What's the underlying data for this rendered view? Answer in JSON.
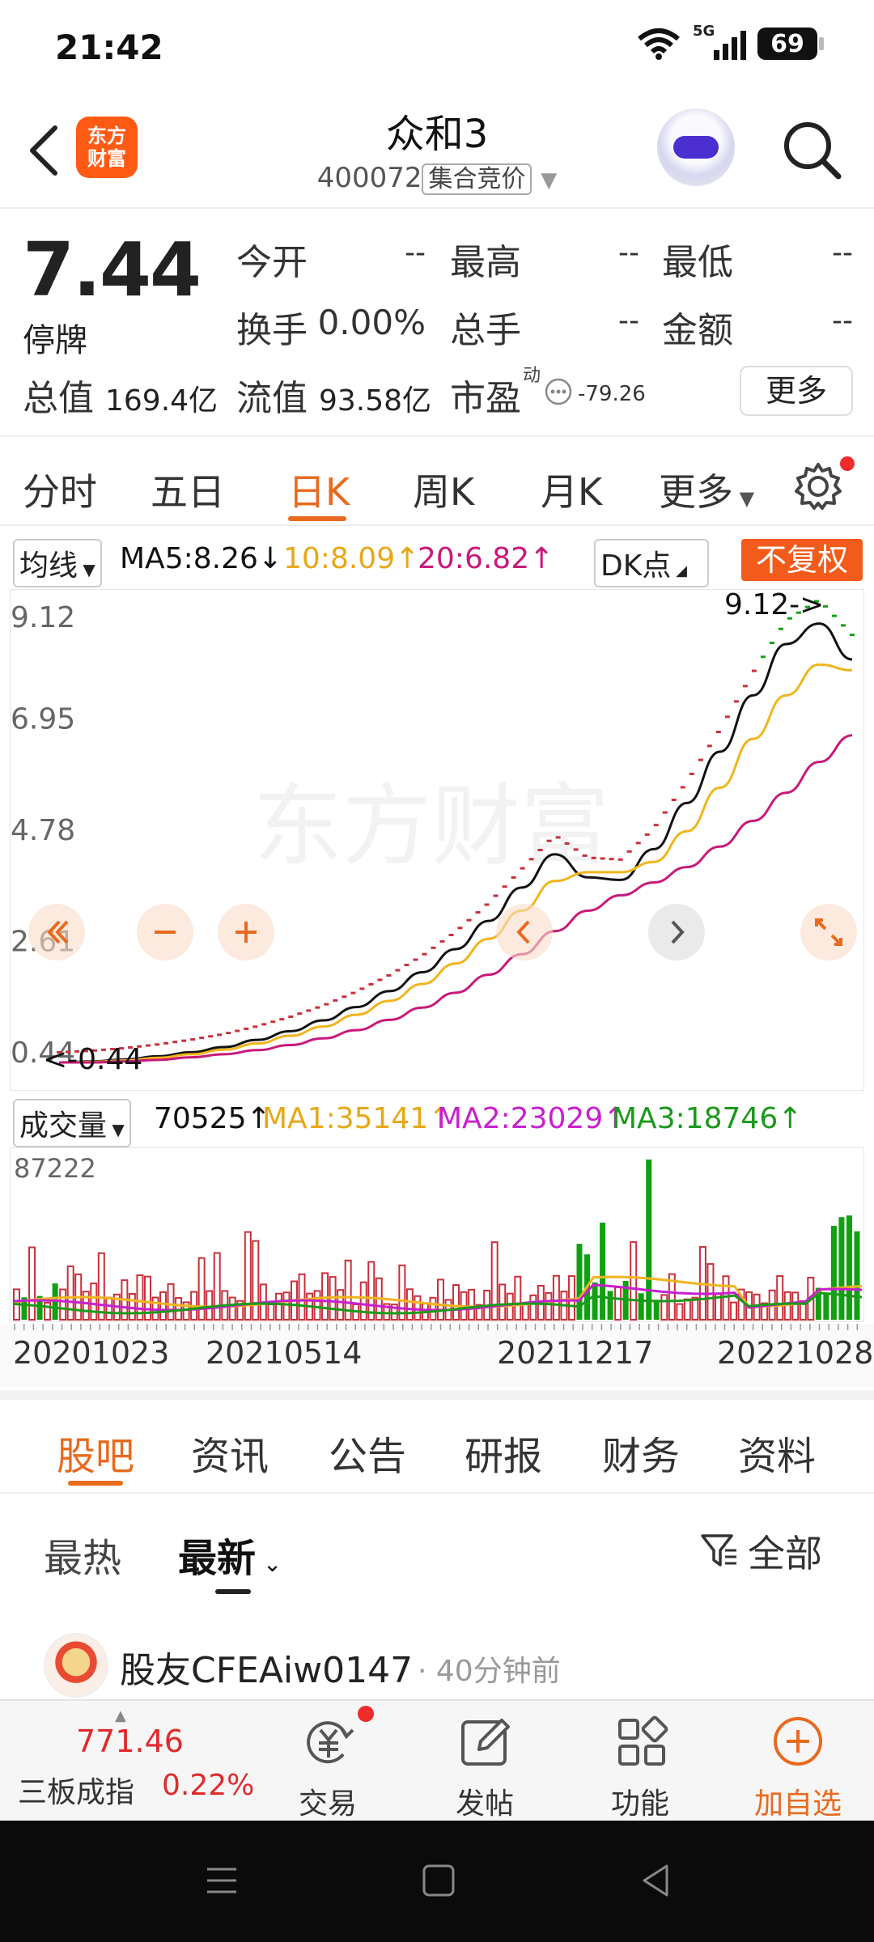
{
  "status_bar": {
    "time": "21:42",
    "network": "5G",
    "battery": "69"
  },
  "header": {
    "logo_line1": "东方",
    "logo_line2": "财富",
    "stock_name": "众和3",
    "stock_code": "400072",
    "trade_mode": "集合竞价"
  },
  "quote": {
    "price": "7.44",
    "status": "停牌",
    "open_label": "今开",
    "open_value": "--",
    "high_label": "最高",
    "high_value": "--",
    "low_label": "最低",
    "low_value": "--",
    "turnover_label": "换手",
    "turnover_value": "0.00%",
    "volume_label": "总手",
    "volume_value": "--",
    "amount_label": "金额",
    "amount_value": "--",
    "mktcap_label": "总值",
    "mktcap_value": "169.4亿",
    "float_label": "流值",
    "float_value": "93.58亿",
    "pe_label": "市盈",
    "pe_sup": "动",
    "pe_value": "-79.26",
    "more_label": "更多"
  },
  "period_tabs": [
    "分时",
    "五日",
    "日K",
    "周K",
    "月K",
    "更多"
  ],
  "ma_row": {
    "selector": "均线",
    "ma5": "MA5:8.26",
    "ma10": "10:8.09",
    "ma20": "20:6.82",
    "dk_label": "DK点",
    "fq_label": "不复权",
    "colors": {
      "ma5": "#111111",
      "ma10": "#f1b51c",
      "ma20": "#c8197a"
    }
  },
  "chart_data": {
    "type": "line",
    "y_axis_labels": [
      "9.12",
      "6.95",
      "4.78",
      "2.61",
      "0.44"
    ],
    "ylim": [
      0.44,
      9.12
    ],
    "max_marker": "9.12->",
    "min_marker": "<-0.44",
    "watermark": "东方财富",
    "series": [
      {
        "name": "MA5",
        "color": "#111111",
        "values": [
          0.44,
          0.46,
          0.5,
          0.56,
          0.64,
          0.74,
          0.88,
          1.05,
          1.26,
          1.52,
          1.83,
          2.2,
          2.65,
          3.2,
          3.85,
          4.5,
          4.05,
          4.0,
          4.6,
          5.5,
          6.5,
          7.6,
          8.6,
          9.0,
          8.3
        ]
      },
      {
        "name": "MA10",
        "color": "#f1b51c",
        "values": [
          0.44,
          0.45,
          0.48,
          0.53,
          0.6,
          0.69,
          0.81,
          0.96,
          1.14,
          1.37,
          1.64,
          1.97,
          2.37,
          2.85,
          3.4,
          3.98,
          4.15,
          4.15,
          4.35,
          4.95,
          5.8,
          6.75,
          7.6,
          8.2,
          8.09
        ]
      },
      {
        "name": "MA20",
        "color": "#c8197a",
        "values": [
          0.44,
          0.44,
          0.46,
          0.49,
          0.54,
          0.6,
          0.68,
          0.78,
          0.91,
          1.07,
          1.27,
          1.51,
          1.8,
          2.15,
          2.55,
          3.0,
          3.4,
          3.7,
          3.95,
          4.25,
          4.65,
          5.15,
          5.7,
          6.3,
          6.82
        ]
      }
    ],
    "volume": {
      "selector": "成交量",
      "value": "70525",
      "ma1": "MA1:35141",
      "ma2": "MA2:23029",
      "ma3": "MA3:18746",
      "max_label": "87222",
      "colors": {
        "ma1": "#f1b51c",
        "ma2": "#c81fd0",
        "ma3": "#1a9a1a",
        "down": "#11a011",
        "up": "#c8303a"
      },
      "dates": [
        "20201023",
        "20210514",
        "20211217",
        "20221028"
      ]
    }
  },
  "content_tabs": [
    "股吧",
    "资讯",
    "公告",
    "研报",
    "财务",
    "资料"
  ],
  "sort": {
    "hot": "最热",
    "latest": "最新",
    "filter": "全部"
  },
  "post": {
    "user": "股友CFEAiw0147",
    "time": "· 40分钟前"
  },
  "bottom_bar": {
    "index_value": "771.46",
    "index_name": "三板成指",
    "index_change": "0.22%",
    "trade": "交易",
    "post": "发帖",
    "function": "功能",
    "add": "加自选"
  }
}
